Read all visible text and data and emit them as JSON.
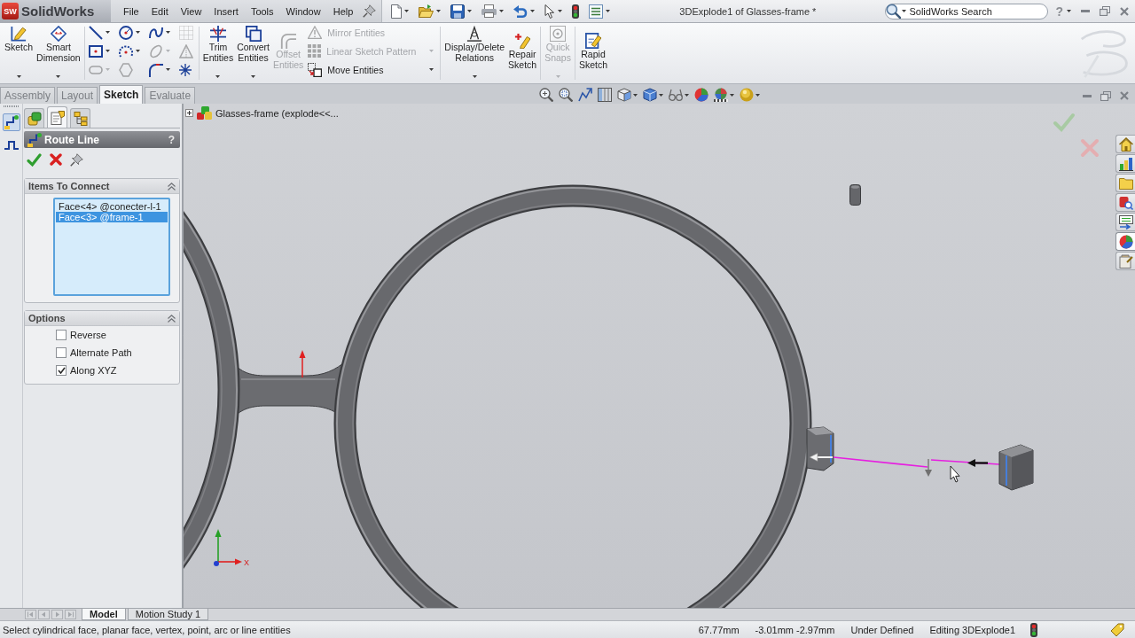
{
  "title_bar": {
    "logo_mark": "SW",
    "app_name": "SolidWorks",
    "menu": [
      "File",
      "Edit",
      "View",
      "Insert",
      "Tools",
      "Window",
      "Help"
    ],
    "quick_access": [
      {
        "dropdown": true
      },
      {
        "dropdown": true
      },
      {
        "dropdown": true
      },
      {
        "dropdown": true
      },
      {
        "dropdown": true
      },
      {
        "dropdown": true
      },
      {
        "dropdown": false
      },
      {
        "dropdown": true
      }
    ],
    "document_title": "3DExplode1 of Glasses-frame *",
    "search": {
      "placeholder": "SolidWorks Search"
    },
    "help": "?"
  },
  "command_manager": {
    "groups": [
      {
        "items": [
          {
            "kind": "large",
            "label": "Sketch",
            "dropdown": true,
            "disabled": false
          },
          {
            "kind": "large",
            "label": "Smart\nDimension",
            "dropdown": true,
            "disabled": false
          }
        ]
      },
      {
        "items": [
          {
            "kind": "grid",
            "tools": [
              {
                "dropdown": true,
                "disabled": false
              },
              {
                "dropdown": true,
                "disabled": false
              },
              {
                "dropdown": true,
                "disabled": false
              },
              {
                "dropdown": false,
                "disabled": true
              },
              {
                "dropdown": true,
                "disabled": false
              },
              {
                "dropdown": true,
                "disabled": false
              },
              {
                "dropdown": true,
                "disabled": true
              },
              {
                "dropdown": false,
                "disabled": true
              },
              {
                "dropdown": true,
                "disabled": true
              },
              {
                "dropdown": false,
                "disabled": true
              },
              {
                "dropdown": true,
                "disabled": false
              },
              {
                "dropdown": false,
                "disabled": false
              }
            ]
          }
        ]
      },
      {
        "items": [
          {
            "kind": "large",
            "label": "Trim\nEntities",
            "dropdown": true,
            "disabled": false
          },
          {
            "kind": "large",
            "label": "Convert\nEntities",
            "dropdown": true,
            "disabled": false
          },
          {
            "kind": "large",
            "label": "Offset\nEntities",
            "dropdown": false,
            "disabled": true
          },
          {
            "kind": "stack",
            "rows": [
              {
                "label": "Mirror Entities",
                "dropdown": false,
                "disabled": true
              },
              {
                "label": "Linear Sketch Pattern",
                "dropdown": true,
                "disabled": true
              },
              {
                "label": "Move Entities",
                "dropdown": true,
                "disabled": false
              }
            ]
          }
        ]
      },
      {
        "items": [
          {
            "kind": "large",
            "label": "Display/Delete\nRelations",
            "dropdown": true,
            "disabled": false
          },
          {
            "kind": "large",
            "label": "Repair\nSketch",
            "dropdown": false,
            "disabled": false
          }
        ]
      },
      {
        "items": [
          {
            "kind": "large",
            "label": "Quick\nSnaps",
            "dropdown": true,
            "disabled": true
          }
        ]
      },
      {
        "items": [
          {
            "kind": "large",
            "label": "Rapid\nSketch",
            "dropdown": false,
            "disabled": false
          }
        ]
      }
    ]
  },
  "tabs": [
    {
      "label": "Assembly",
      "selected": false
    },
    {
      "label": "Layout",
      "selected": false
    },
    {
      "label": "Sketch",
      "selected": true
    },
    {
      "label": "Evaluate",
      "selected": false
    }
  ],
  "view_toolbar": [
    {
      "dropdown": false
    },
    {
      "dropdown": false
    },
    {
      "dropdown": false
    },
    {
      "dropdown": false
    },
    {
      "dropdown": true
    },
    {
      "dropdown": true
    },
    {
      "dropdown": true
    },
    {
      "dropdown": false
    },
    {
      "dropdown": true
    },
    {
      "dropdown": true
    }
  ],
  "property_manager": {
    "side_tools": [
      {
        "selected": true
      },
      {
        "selected": false
      }
    ],
    "panel_tabs": [
      {
        "selected": false
      },
      {
        "selected": true
      },
      {
        "selected": false
      }
    ],
    "title": "Route Line",
    "help": "?",
    "groups": [
      {
        "kind": "selection_list",
        "title": "Items To Connect",
        "expanded": true,
        "items": [
          {
            "label": "Face<4> @conecter-l-1",
            "selected": false
          },
          {
            "label": "Face<3> @frame-1",
            "selected": true
          }
        ]
      },
      {
        "kind": "options",
        "title": "Options",
        "expanded": true,
        "items": [
          {
            "label": "Reverse",
            "checked": false
          },
          {
            "label": "Alternate Path",
            "checked": false
          },
          {
            "label": "Along XYZ",
            "checked": true
          }
        ]
      }
    ]
  },
  "graphics_area": {
    "tree_item": {
      "label": "Glasses-frame (explode<<...",
      "expanded": false
    },
    "triad": {
      "label": "X"
    },
    "task_pane_tabs": [
      {
        "selected": false
      },
      {
        "selected": false
      },
      {
        "selected": false
      },
      {
        "selected": false
      },
      {
        "selected": false
      },
      {
        "selected": true
      },
      {
        "selected": false
      }
    ]
  },
  "bottom_tabs": [
    {
      "label": "Model",
      "selected": true
    },
    {
      "label": "Motion Study 1",
      "selected": false
    }
  ],
  "status_bar": {
    "message": "Select cylindrical face, planar face, vertex, point, arc or line entities",
    "fields": [
      "67.77mm",
      "-3.01mm -2.97mm",
      "Under Defined",
      "Editing 3DExplode1"
    ]
  }
}
